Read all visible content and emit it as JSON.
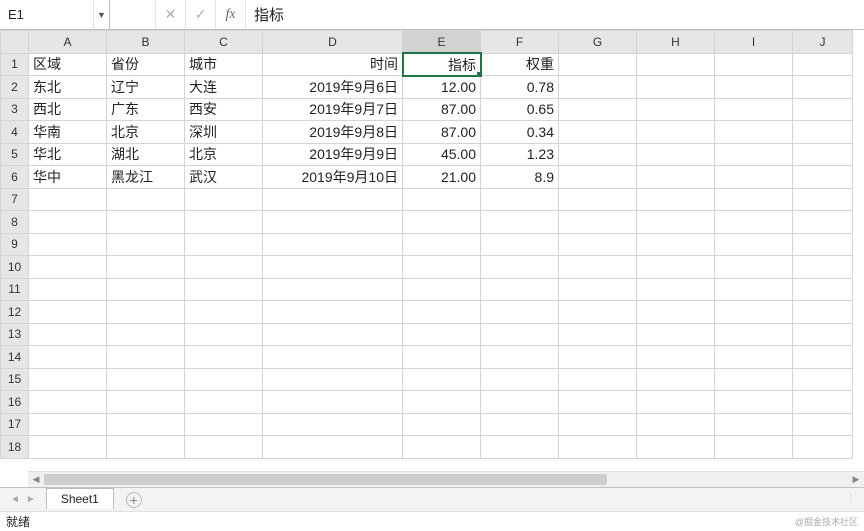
{
  "name_box": "E1",
  "formula_value": "指标",
  "columns": [
    "A",
    "B",
    "C",
    "D",
    "E",
    "F",
    "G",
    "H",
    "I",
    "J"
  ],
  "selected_column_index": 4,
  "selected_cell": "E1",
  "row_count": 18,
  "headers": {
    "A": "区域",
    "B": "省份",
    "C": "城市",
    "D": "时间",
    "E": "指标",
    "F": "权重"
  },
  "rows": [
    {
      "A": "东北",
      "B": "辽宁",
      "C": "大连",
      "D": "2019年9月6日",
      "E": "12.00",
      "F": "0.78"
    },
    {
      "A": "西北",
      "B": "广东",
      "C": "西安",
      "D": "2019年9月7日",
      "E": "87.00",
      "F": "0.65"
    },
    {
      "A": "华南",
      "B": "北京",
      "C": "深圳",
      "D": "2019年9月8日",
      "E": "87.00",
      "F": "0.34"
    },
    {
      "A": "华北",
      "B": "湖北",
      "C": "北京",
      "D": "2019年9月9日",
      "E": "45.00",
      "F": "1.23"
    },
    {
      "A": "华中",
      "B": "黑龙江",
      "C": "武汉",
      "D": "2019年9月10日",
      "E": "21.00",
      "F": "8.9"
    }
  ],
  "align": {
    "A": "l",
    "B": "l",
    "C": "l",
    "D": "r",
    "E": "r",
    "F": "r"
  },
  "sheet_tab": "Sheet1",
  "status_text": "就绪",
  "watermark": "@掘金技术社区",
  "icons": {
    "cancel": "✕",
    "confirm": "✓",
    "fx": "fx",
    "dropdown": "▼",
    "nav_first": "◄",
    "nav_last": "►",
    "add": "+",
    "more": "⋮",
    "left": "◀",
    "right": "▶"
  }
}
